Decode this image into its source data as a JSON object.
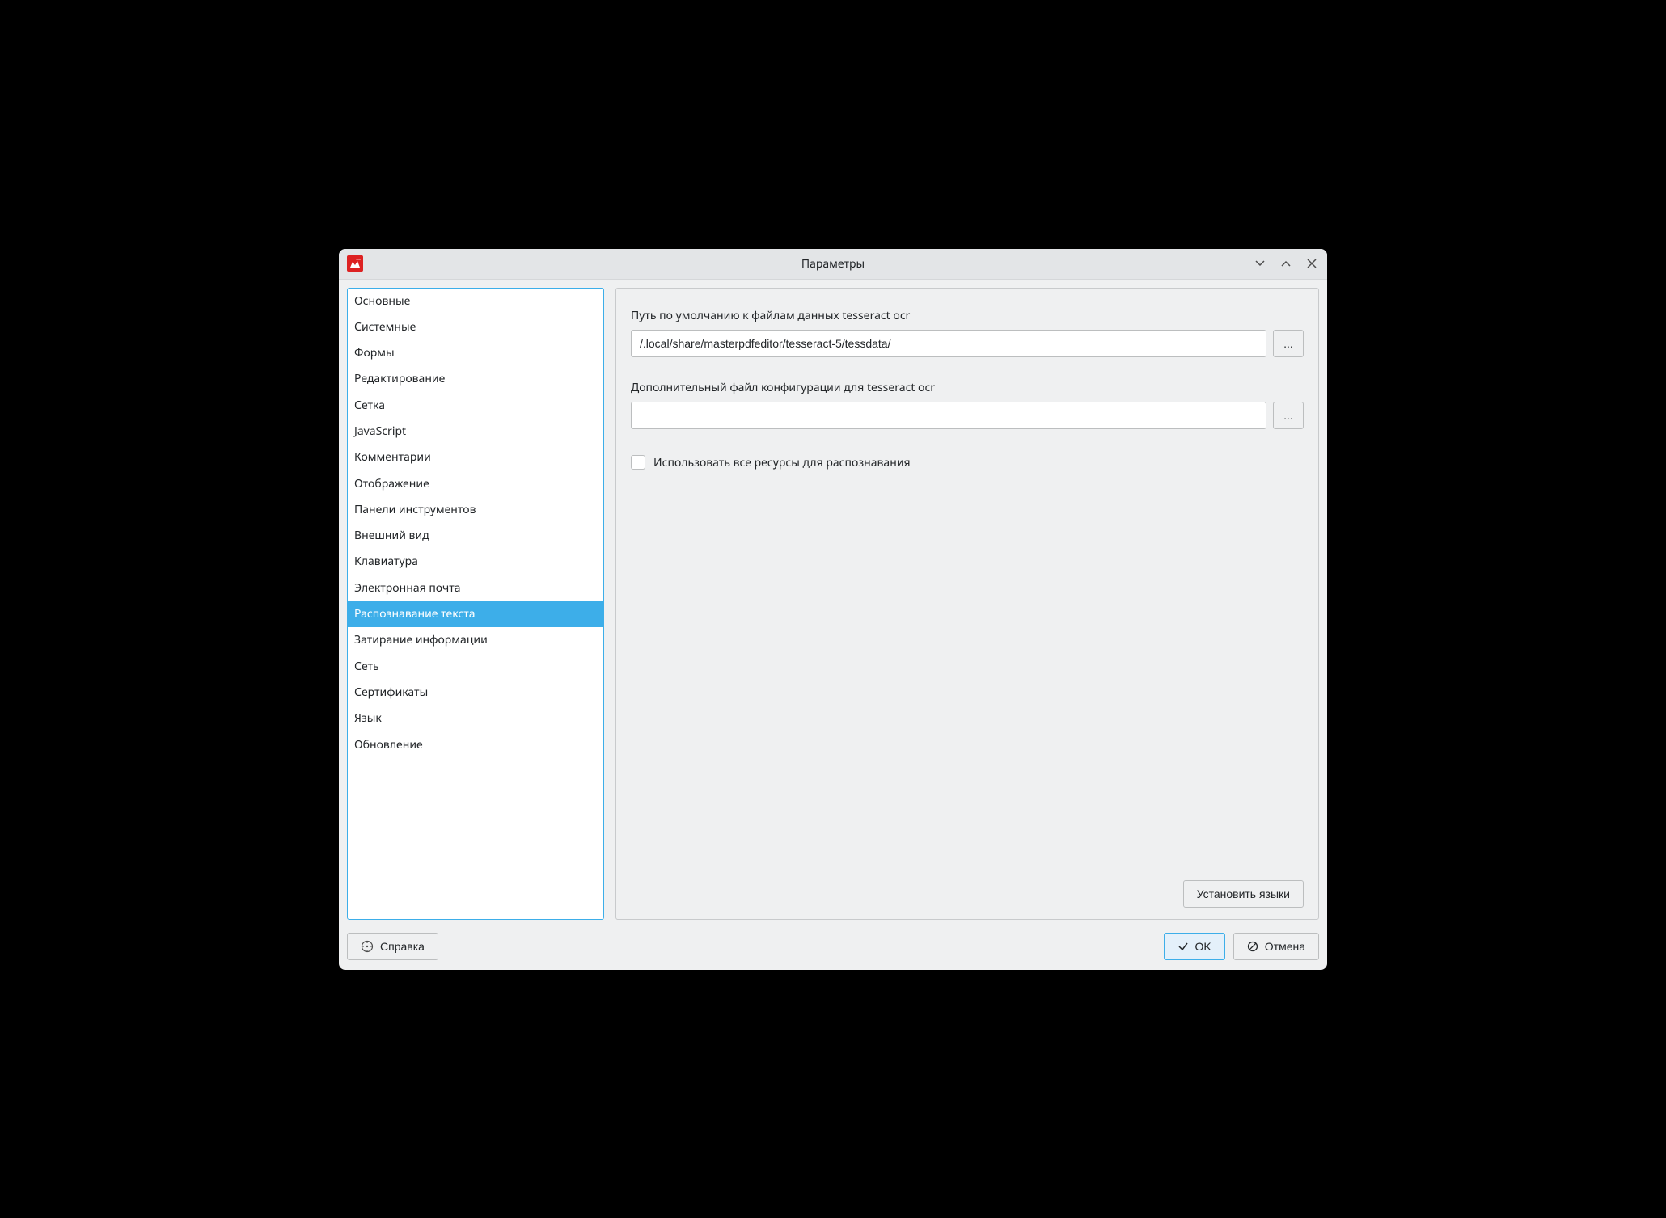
{
  "window": {
    "title": "Параметры"
  },
  "sidebar": {
    "items": [
      {
        "label": "Основные"
      },
      {
        "label": "Системные"
      },
      {
        "label": "Формы"
      },
      {
        "label": "Редактирование"
      },
      {
        "label": "Сетка"
      },
      {
        "label": "JavaScript"
      },
      {
        "label": "Комментарии"
      },
      {
        "label": "Отображение"
      },
      {
        "label": "Панели инструментов"
      },
      {
        "label": "Внешний вид"
      },
      {
        "label": "Клавиатура"
      },
      {
        "label": "Электронная почта"
      },
      {
        "label": "Распознавание текста"
      },
      {
        "label": "Затирание информации"
      },
      {
        "label": "Сеть"
      },
      {
        "label": "Сертификаты"
      },
      {
        "label": "Язык"
      },
      {
        "label": "Обновление"
      }
    ],
    "selected_index": 12
  },
  "form": {
    "tessdata_label": "Путь по умолчанию к файлам данных tesseract ocr",
    "tessdata_value": "/.local/share/masterpdfeditor/tesseract-5/tessdata/",
    "config_label": "Дополнительный файл конфигурации для tesseract ocr",
    "config_value": "",
    "browse_label": "...",
    "use_all_resources_label": "Использовать все ресурсы для распознавания",
    "use_all_resources_checked": false,
    "install_languages_label": "Установить языки"
  },
  "footer": {
    "help_label": "Справка",
    "ok_label": "OK",
    "cancel_label": "Отмена"
  }
}
